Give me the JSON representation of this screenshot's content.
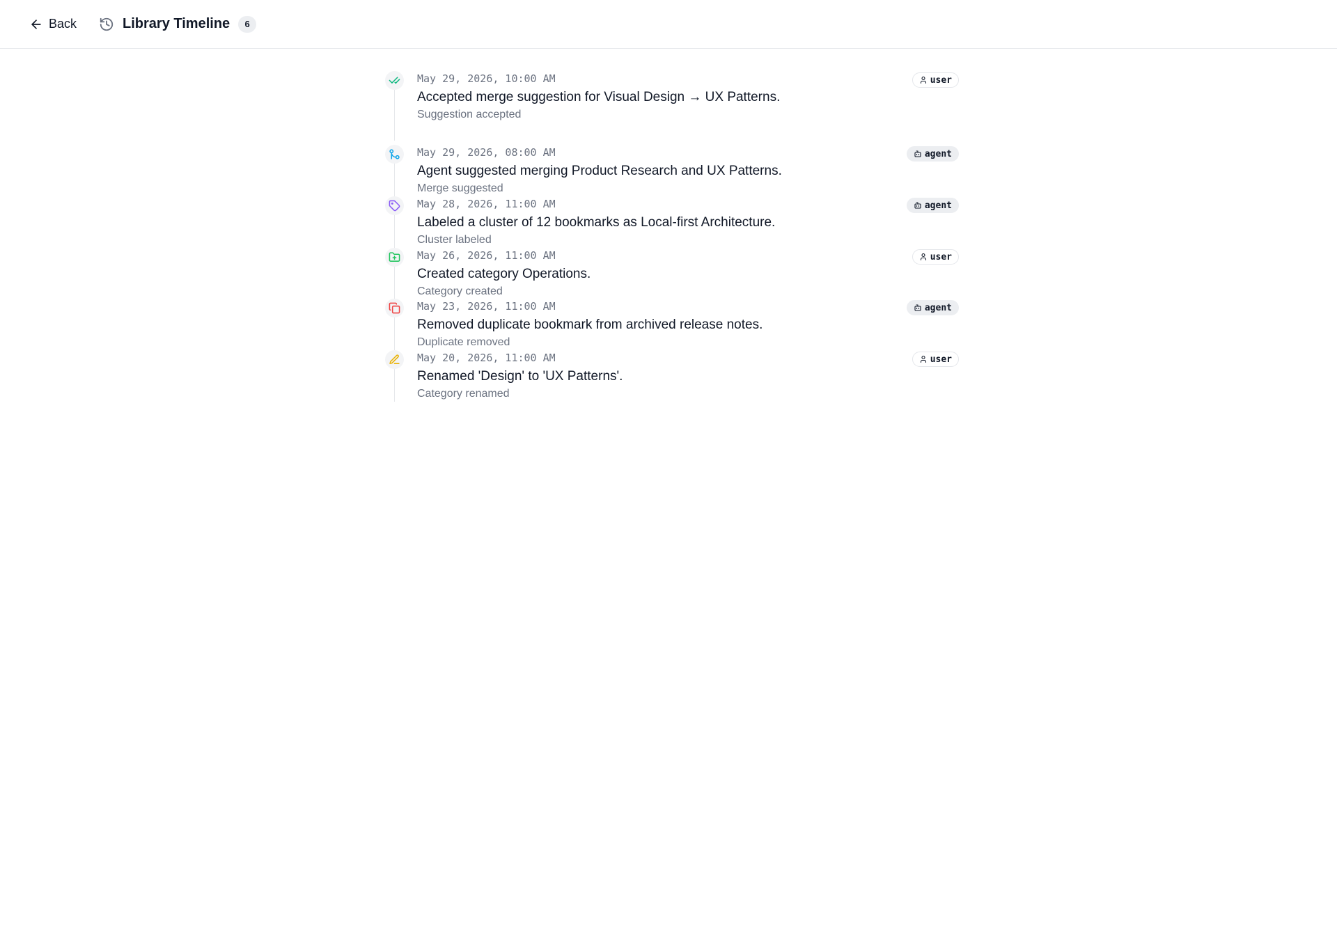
{
  "header": {
    "back_label": "Back",
    "title": "Library Timeline",
    "count": "6"
  },
  "events": [
    {
      "time": "May 29, 2026, 10:00 AM",
      "description": "Accepted merge suggestion for Visual Design → UX Patterns.",
      "label": "Suggestion accepted",
      "actor": "user",
      "icon": "check-check-icon",
      "color": "#10b981"
    },
    {
      "time": "May 29, 2026, 08:00 AM",
      "description": "Agent suggested merging Product Research and UX Patterns.",
      "label": "Merge suggested",
      "actor": "agent",
      "icon": "git-merge-icon",
      "color": "#0ea5e9"
    },
    {
      "time": "May 28, 2026, 11:00 AM",
      "description": "Labeled a cluster of 12 bookmarks as Local-first Architecture.",
      "label": "Cluster labeled",
      "actor": "agent",
      "icon": "tag-icon",
      "color": "#8b5cf6"
    },
    {
      "time": "May 26, 2026, 11:00 AM",
      "description": "Created category Operations.",
      "label": "Category created",
      "actor": "user",
      "icon": "folder-plus-icon",
      "color": "#22c55e"
    },
    {
      "time": "May 23, 2026, 11:00 AM",
      "description": "Removed duplicate bookmark from archived release notes.",
      "label": "Duplicate removed",
      "actor": "agent",
      "icon": "copy-icon",
      "color": "#ef4444"
    },
    {
      "time": "May 20, 2026, 11:00 AM",
      "description": "Renamed 'Design' to 'UX Patterns'.",
      "label": "Category renamed",
      "actor": "user",
      "icon": "pencil-icon",
      "color": "#eab308"
    }
  ]
}
